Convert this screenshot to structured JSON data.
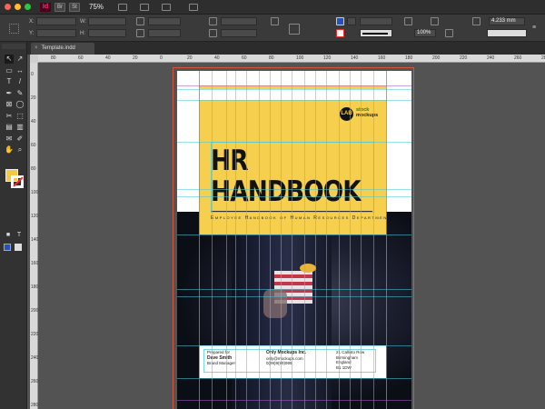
{
  "window": {
    "app_icon": "Id",
    "zoom": "75%",
    "colors": {
      "close": "#fe5f57",
      "minimize": "#febc2e",
      "maximize": "#28c840",
      "accent": "#f6cf4e"
    }
  },
  "control_panel": {
    "labels": {
      "x": "X:",
      "y": "Y:",
      "w": "W:",
      "h": "H:"
    },
    "zoom_percent": "100%",
    "stroke_weight": "4.233 mm"
  },
  "tab": {
    "name": "Template.indd",
    "close": "×"
  },
  "ruler": {
    "h_labels": [
      "80",
      "60",
      "40",
      "20",
      "0",
      "20",
      "40",
      "60",
      "80",
      "100",
      "120",
      "140",
      "160",
      "180",
      "200",
      "220",
      "240",
      "260",
      "280"
    ],
    "v_labels": [
      "0",
      "20",
      "40",
      "60",
      "80",
      "100",
      "120",
      "140",
      "160",
      "180",
      "200",
      "220",
      "240",
      "260",
      "280"
    ]
  },
  "tools": [
    {
      "name": "selection-tool",
      "glyph": "↖"
    },
    {
      "name": "direct-selection-tool",
      "glyph": "↗"
    },
    {
      "name": "page-tool",
      "glyph": "▭"
    },
    {
      "name": "gap-tool",
      "glyph": "↔"
    },
    {
      "name": "type-tool",
      "glyph": "T"
    },
    {
      "name": "line-tool",
      "glyph": "/"
    },
    {
      "name": "pen-tool",
      "glyph": "✒"
    },
    {
      "name": "pencil-tool",
      "glyph": "✎"
    },
    {
      "name": "rectangle-frame-tool",
      "glyph": "⊠"
    },
    {
      "name": "ellipse-tool",
      "glyph": "◯"
    },
    {
      "name": "scissors-tool",
      "glyph": "✂"
    },
    {
      "name": "free-transform-tool",
      "glyph": "⬚"
    },
    {
      "name": "gradient-tool",
      "glyph": "▤"
    },
    {
      "name": "gradient-feather-tool",
      "glyph": "▥"
    },
    {
      "name": "note-tool",
      "glyph": "✉"
    },
    {
      "name": "eyedropper-tool",
      "glyph": "✐"
    },
    {
      "name": "hand-tool",
      "glyph": "✋"
    },
    {
      "name": "zoom-tool",
      "glyph": "⌕"
    }
  ],
  "document": {
    "logo_mark": "LAB",
    "logo_text_1": "stock",
    "logo_text_2": "mockups",
    "title_line_1": "HR",
    "title_line_2": "HANDBOOK",
    "subtitle": "Employee Handbook of Human Resources Department",
    "prepared_for_label": "Prepared for",
    "prepared_name": "Dave Smith",
    "prepared_role": "Brand Manager",
    "company": "Only Mockups Inc.",
    "email": "only@mockups.com",
    "phone": "0(99)9(99)999",
    "address_1": "21 Callisto Row",
    "address_2": "Birmingham",
    "address_3": "England",
    "address_4": "B1 1DW"
  }
}
